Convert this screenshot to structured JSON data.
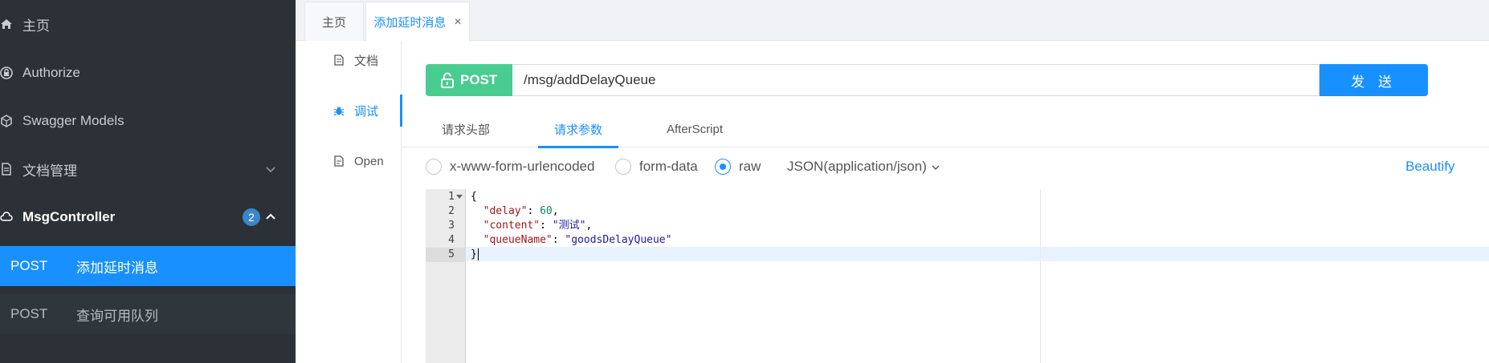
{
  "sidebar": {
    "items": [
      {
        "label": "主页",
        "icon": "home-icon"
      },
      {
        "label": "Authorize",
        "icon": "lock-icon"
      },
      {
        "label": "Swagger Models",
        "icon": "models-icon"
      },
      {
        "label": "文档管理",
        "icon": "document-manage-icon"
      },
      {
        "label": "MsgController",
        "icon": "cloud-icon",
        "badge": "2"
      }
    ],
    "subitems": [
      {
        "method": "POST",
        "label": "添加延时消息"
      },
      {
        "method": "POST",
        "label": "查询可用队列"
      }
    ]
  },
  "tabs": [
    {
      "label": "主页"
    },
    {
      "label": "添加延时消息",
      "close": "×"
    }
  ],
  "vtabs": [
    {
      "label": "文档"
    },
    {
      "label": "调试"
    },
    {
      "label": "Open"
    }
  ],
  "request": {
    "method": "POST",
    "url": "/msg/addDelayQueue",
    "send_label": "发 送"
  },
  "param_tabs": [
    {
      "label": "请求头部"
    },
    {
      "label": "请求参数"
    },
    {
      "label": "AfterScript"
    }
  ],
  "body_types": {
    "options": [
      "x-www-form-urlencoded",
      "form-data",
      "raw"
    ],
    "selected": "raw",
    "content_type": "JSON(application/json)",
    "beautify_label": "Beautify"
  },
  "editor": {
    "line_numbers": [
      "1",
      "2",
      "3",
      "4",
      "5"
    ],
    "lines": [
      {
        "open": "{"
      },
      {
        "key": "\"delay\"",
        "sep": ": ",
        "num": "60",
        "end": ","
      },
      {
        "key": "\"content\"",
        "sep": ": ",
        "str": "\"测试\"",
        "end": ","
      },
      {
        "key": "\"queueName\"",
        "sep": ": ",
        "str": "\"goodsDelayQueue\""
      },
      {
        "close": "}"
      }
    ]
  },
  "colors": {
    "sidebar_bg": "#2b3137",
    "accent": "#1890ff",
    "post_green": "#49cc90"
  }
}
